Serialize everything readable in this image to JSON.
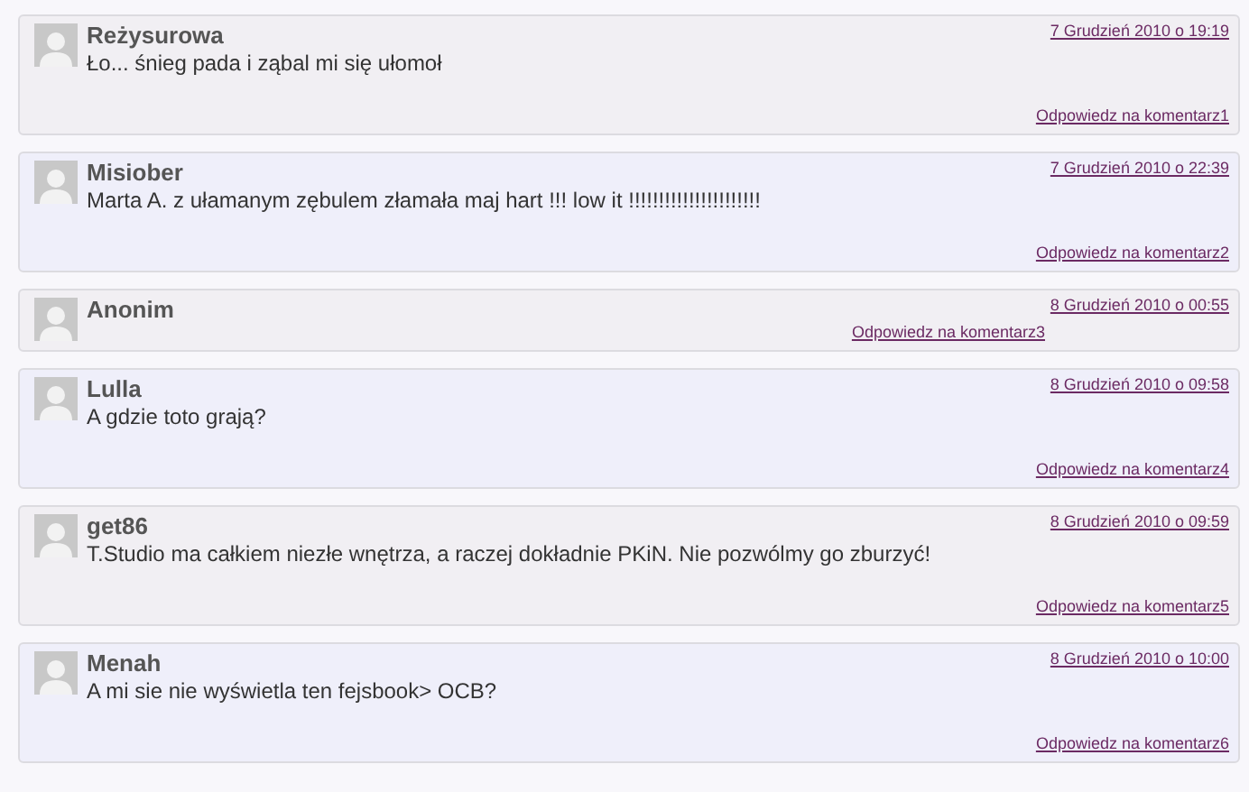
{
  "comments": [
    {
      "author": "Reżysurowa",
      "date": "7 Grudzień 2010 o 19:19",
      "text": "Ło... śnieg pada i ząbal mi się ułomoł",
      "reply": "Odpowiedz na komentarz1",
      "kind": "plain"
    },
    {
      "author": "Misiober",
      "date": "7 Grudzień 2010 o 22:39",
      "text": "Marta A. z ułamanym zębulem złamała maj hart !!! low it !!!!!!!!!!!!!!!!!!!!!!",
      "reply": "Odpowiedz na komentarz2",
      "kind": "alt"
    },
    {
      "author": "Anonim",
      "date": "8 Grudzień 2010 o 00:55",
      "reply": "Odpowiedz na komentarz3",
      "kind": "plain"
    },
    {
      "author": "Lulla",
      "date": "8 Grudzień 2010 o 09:58",
      "text": "A gdzie toto grają?",
      "reply": "Odpowiedz na komentarz4",
      "kind": "alt"
    },
    {
      "author": "get86",
      "date": "8 Grudzień 2010 o 09:59",
      "text": "T.Studio ma całkiem niezłe wnętrza, a raczej dokładnie PKiN. Nie pozwólmy go zburzyć!",
      "reply": "Odpowiedz na komentarz5",
      "kind": "plain"
    },
    {
      "author": "Menah",
      "date": "8 Grudzień 2010 o 10:00",
      "text": "A mi sie nie wyświetla ten fejsbook> OCB?",
      "reply": "Odpowiedz na komentarz6",
      "kind": "alt"
    }
  ]
}
